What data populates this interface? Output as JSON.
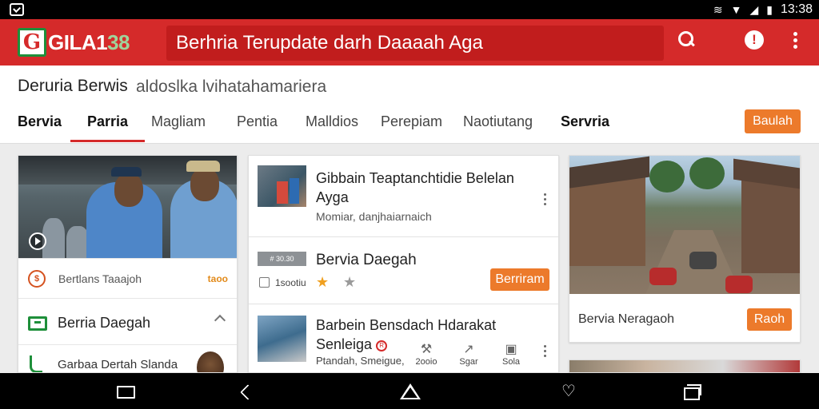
{
  "status_bar": {
    "time": "13:38",
    "icons": [
      "notification-icon",
      "vibrate-icon",
      "wifi-icon",
      "signal-icon",
      "battery-icon"
    ]
  },
  "app_bar": {
    "logo_mark": "G",
    "logo_text_main": "GILA1",
    "logo_text_accent": "38",
    "search_text": "Berhria Terupdate darh Daaaah Aga",
    "icons": [
      "search-icon",
      "alert-icon",
      "more-vert-icon"
    ],
    "colors": {
      "primary": "#d52a2a",
      "accent": "#ec7a2b"
    }
  },
  "page_header": {
    "title": "Deruria  Berwis",
    "subtitle": "aldoslka lvihatahamariera",
    "action_button": "Baulah",
    "tabs": [
      {
        "label": "Bervia",
        "style": "bold"
      },
      {
        "label": "Parria",
        "style": "active"
      },
      {
        "label": "Magliam",
        "style": "normal"
      },
      {
        "label": "Pentia",
        "style": "normal"
      },
      {
        "label": "Malldios",
        "style": "normal"
      },
      {
        "label": "Perepiam",
        "style": "normal"
      },
      {
        "label": "Naotiutang",
        "style": "normal"
      },
      {
        "label": "Servria",
        "style": "bold"
      }
    ]
  },
  "left_card": {
    "row1_label": "Bertlans Taaajoh",
    "row1_badge": "taoo",
    "row2_title": "Berria Daegah",
    "row3_label": "Garbaa Dertah Slanda"
  },
  "middle_card": {
    "item1": {
      "title": "Gibbain Teaptanchtidie Belelan Ayga",
      "meta": "Momiar, danjhaiarnaich"
    },
    "item2": {
      "thumb_text": "# 30.30",
      "title": "Bervia Daegah",
      "meta": "1sootiu",
      "button": "Berriram",
      "star_colors": [
        "#f0a020",
        "#9a9a9a"
      ]
    },
    "item3": {
      "title": "Barbein Bensdach Hdarakat Senleiga",
      "meta": "Ptandah, Smeigue,",
      "actions": [
        {
          "icon": "gavel-icon",
          "label": "2ooio"
        },
        {
          "icon": "chart-icon",
          "label": "Sgar"
        },
        {
          "icon": "chat-icon",
          "label": "Sola"
        }
      ]
    }
  },
  "right_card": {
    "label": "Bervia Neragaoh",
    "button": "Raoh"
  },
  "nav_bar": {
    "icons": [
      "window-icon",
      "back-icon",
      "home-icon",
      "favorite-icon",
      "recents-icon"
    ]
  }
}
